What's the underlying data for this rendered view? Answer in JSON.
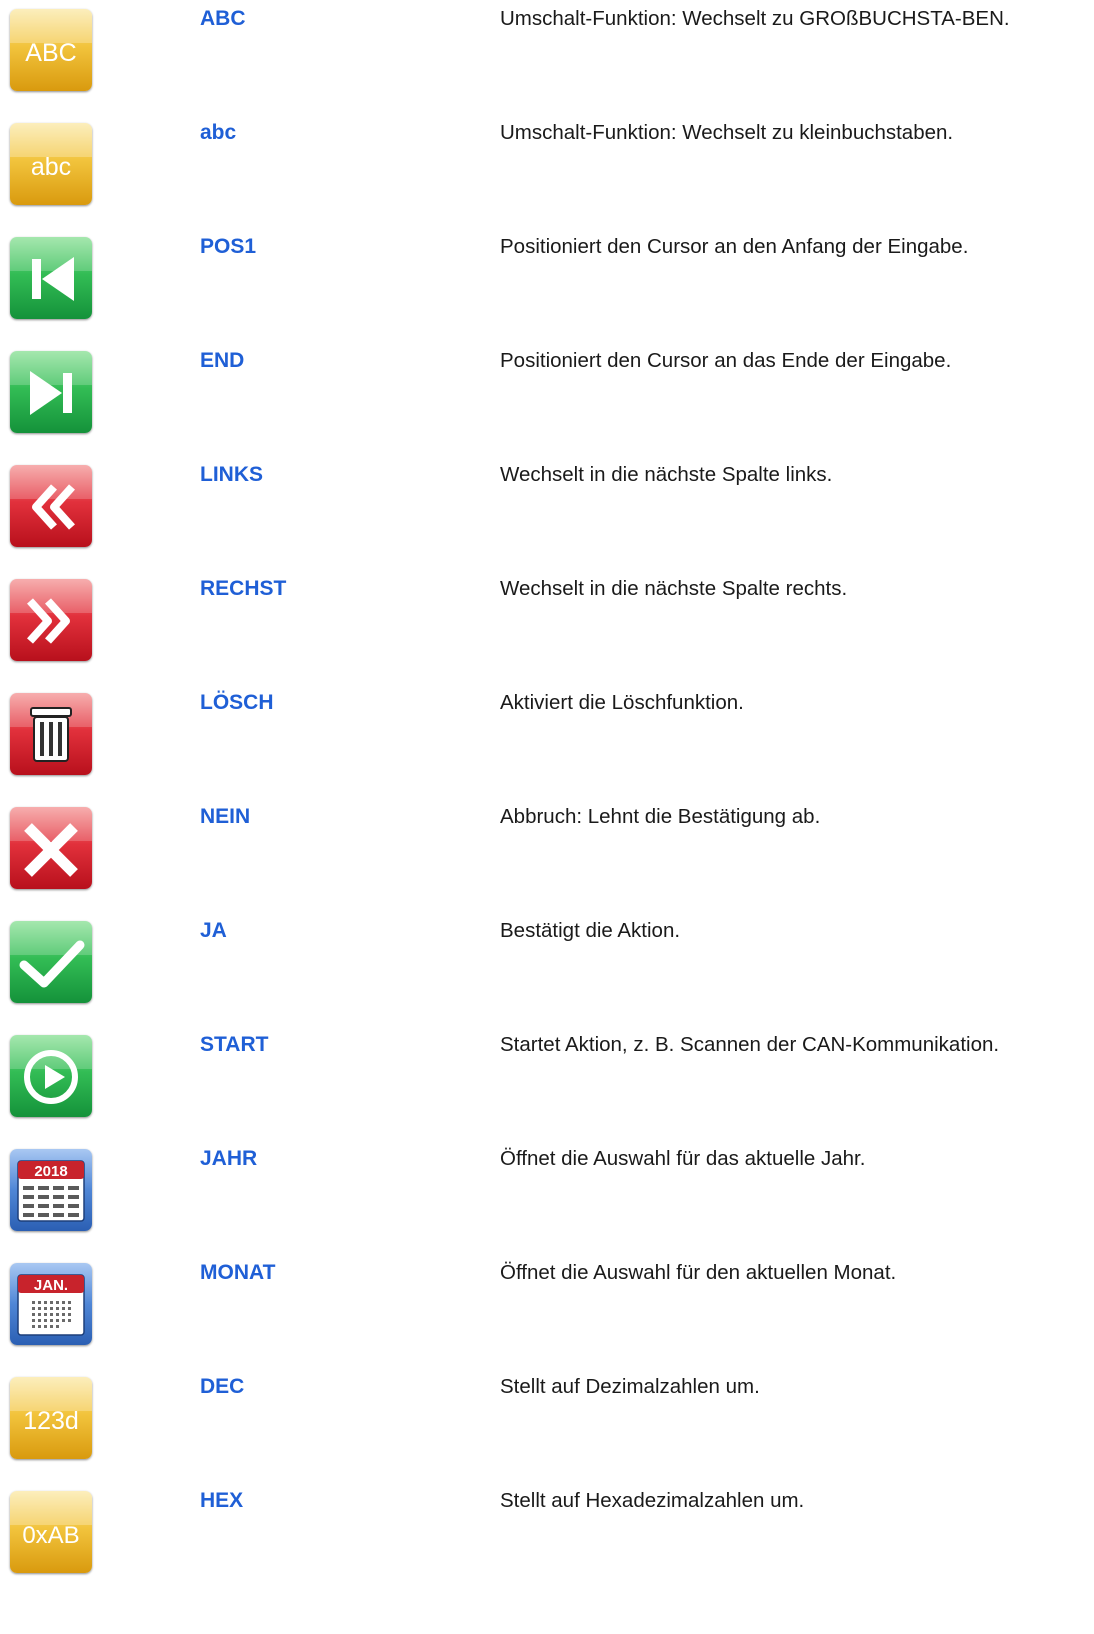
{
  "colors": {
    "key_name": "#1f5fd6",
    "description_text": "#1a1a1a",
    "yellow_icon": "#e6ab1c",
    "green_icon": "#2bb150",
    "red_icon": "#d9202d",
    "blue_icon": "#2f6cc4"
  },
  "rows": [
    {
      "icon": "uppercase-abc-icon",
      "icon_text": "ABC",
      "name": "ABC",
      "description": "Umschalt-Funktion: Wechselt zu GROßBUCHSTA-BEN."
    },
    {
      "icon": "lowercase-abc-icon",
      "icon_text": "abc",
      "name": "abc",
      "description": "Umschalt-Funktion: Wechselt zu kleinbuchstaben."
    },
    {
      "icon": "skip-to-start-icon",
      "name": "POS1",
      "description": "Positioniert den Cursor an den Anfang der Eingabe."
    },
    {
      "icon": "skip-to-end-icon",
      "name": "END",
      "description": "Positioniert den Cursor an das Ende der Eingabe."
    },
    {
      "icon": "double-chevron-left-icon",
      "name": "LINKS",
      "description": "Wechselt in die nächste Spalte links."
    },
    {
      "icon": "double-chevron-right-icon",
      "name": "RECHST",
      "description": "Wechselt in die nächste Spalte rechts."
    },
    {
      "icon": "trash-icon",
      "name": "LÖSCH",
      "description": "Aktiviert die Löschfunktion."
    },
    {
      "icon": "cross-icon",
      "name": "NEIN",
      "description": "Abbruch: Lehnt die Bestätigung ab."
    },
    {
      "icon": "checkmark-icon",
      "name": "JA",
      "description": "Bestätigt die Aktion."
    },
    {
      "icon": "play-circle-icon",
      "name": "START",
      "description": "Startet Aktion, z. B. Scannen der CAN-Kommunikation."
    },
    {
      "icon": "calendar-year-icon",
      "icon_text": "2018",
      "name": "JAHR",
      "description": "Öffnet die Auswahl für das aktuelle Jahr."
    },
    {
      "icon": "calendar-month-icon",
      "icon_text": "JAN.",
      "name": "MONAT",
      "description": "Öffnet die Auswahl für den aktuellen Monat."
    },
    {
      "icon": "decimal-icon",
      "icon_text": "123d",
      "name": "DEC",
      "description": "Stellt auf Dezimalzahlen um."
    },
    {
      "icon": "hex-icon",
      "icon_text": "0xAB",
      "name": "HEX",
      "description": "Stellt auf Hexadezimalzahlen um."
    }
  ]
}
